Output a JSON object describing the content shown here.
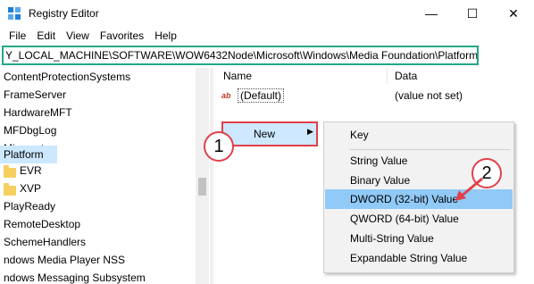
{
  "window": {
    "title": "Registry Editor",
    "minimize_glyph": "—",
    "maximize_glyph": "☐",
    "close_glyph": "✕"
  },
  "menubar": [
    "File",
    "Edit",
    "View",
    "Favorites",
    "Help"
  ],
  "address": {
    "path": "Y_LOCAL_MACHINE\\SOFTWARE\\WOW6432Node\\Microsoft\\Windows\\Media Foundation\\Platform"
  },
  "tree": {
    "items": [
      {
        "label": "ContentProtectionSystems"
      },
      {
        "label": "FrameServer"
      },
      {
        "label": "HardwareMFT"
      },
      {
        "label": "MFDbgLog"
      },
      {
        "label": "Miracast"
      },
      {
        "label": "Platform",
        "selected": true
      },
      {
        "label": "EVR",
        "folder": true
      },
      {
        "label": "XVP",
        "folder": true
      },
      {
        "label": "PlayReady"
      },
      {
        "label": "RemoteDesktop"
      },
      {
        "label": "SchemeHandlers"
      },
      {
        "label": "ndows Media Player NSS"
      },
      {
        "label": "ndows Messaging Subsystem"
      }
    ]
  },
  "list": {
    "columns": {
      "name": "Name",
      "data": "Data"
    },
    "rows": [
      {
        "icon": "string-value-icon",
        "icon_text": "ab",
        "name": "(Default)",
        "data": "(value not set)"
      }
    ]
  },
  "context_menu": {
    "new_label": "New",
    "arrow_glyph": "▶"
  },
  "submenu": {
    "items": [
      {
        "label": "Key"
      },
      {
        "label": "String Value"
      },
      {
        "label": "Binary Value"
      },
      {
        "label": "DWORD (32-bit) Value",
        "highlight": true
      },
      {
        "label": "QWORD (64-bit) Value"
      },
      {
        "label": "Multi-String Value"
      },
      {
        "label": "Expandable String Value"
      }
    ]
  },
  "callouts": [
    "1",
    "2"
  ],
  "colors": {
    "accent_highlight": "#91c9f7",
    "annotation_red": "#e0404a",
    "address_border": "#22a88a",
    "selection": "#cce8ff"
  }
}
